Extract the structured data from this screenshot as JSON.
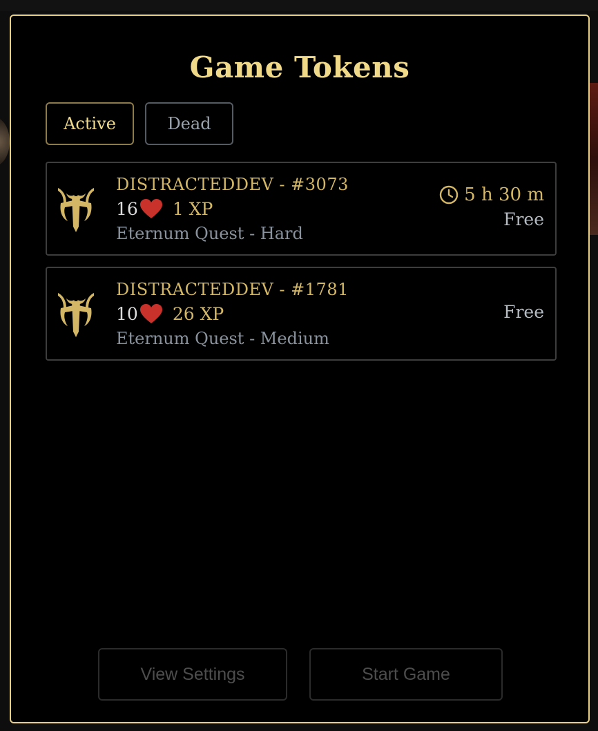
{
  "modal": {
    "title": "Game Tokens"
  },
  "tabs": [
    {
      "label": "Active",
      "selected": true
    },
    {
      "label": "Dead",
      "selected": false
    }
  ],
  "tokens": [
    {
      "name": "DISTRACTEDDEV - #3073",
      "health": "16",
      "xp": "1 XP",
      "game": "Eternum Quest - Hard",
      "timer": "5 h 30 m",
      "price": "Free"
    },
    {
      "name": "DISTRACTEDDEV - #1781",
      "health": "10",
      "xp": "26 XP",
      "game": "Eternum Quest - Medium",
      "timer": "",
      "price": "Free"
    }
  ],
  "footer": {
    "settings_label": "View Settings",
    "start_label": "Start Game"
  },
  "colors": {
    "accent_gold": "#f1d98a",
    "border_gold": "#e7cf86",
    "heart_red": "#c8322b",
    "disabled_text": "#4d4d4d"
  },
  "icons": {
    "token_logo": "eternum-emblem-icon",
    "health": "heart-icon",
    "timer": "clock-icon"
  }
}
